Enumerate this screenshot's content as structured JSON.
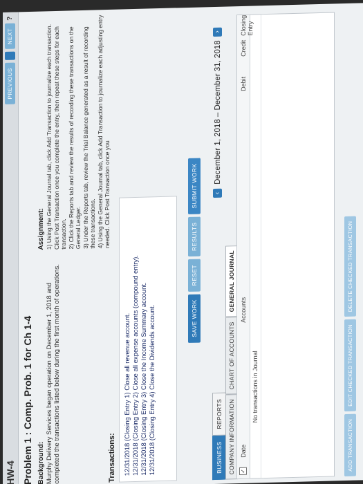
{
  "header": {
    "hw_title": "HW-4",
    "previous": "Previous",
    "next": "Next",
    "help": "?"
  },
  "problem": {
    "title": "Problem 1 : Comp. Prob. 1 for Ch 1-4"
  },
  "background": {
    "heading": "Background:",
    "text": "Murphy Delivery Services began operation on December 1, 2018 and completed the transactions listed below during the first month of operations."
  },
  "assignment": {
    "heading": "Assignment:",
    "items": [
      "1) Using the General Journal tab, click Add Transaction to journalize each transaction. Click Post Transaction once you complete the entry, then repeat these steps for each transaction.",
      "2) Click the Reports tab and review the results of recording these transactions on the General Ledger.",
      "3) Under the Reports tab, review the Trial Balance generated as a result of recording these transactions.",
      "4) Using the General Journal tab, click Add Transaction to journalize each adjusting entry needed. Click Post Transaction once you"
    ]
  },
  "transactions": {
    "heading": "Transactions:",
    "items": [
      "12/31/2018 (Closing Entry 1) Close all revenue account.",
      "12/31/2018 (Closing Entry 2) Close all expense accounts (compound entry).",
      "12/31/2018 (Closing Entry 3) Close the Income Summary account.",
      "12/31/2018 (Closing Entry 4) Close the Dividends account."
    ]
  },
  "actions": {
    "save": "Save Work",
    "reset": "Reset",
    "results": "Results",
    "submit": "Submit Work"
  },
  "tabs_top": [
    "Business",
    "Reports"
  ],
  "date_range": "December 1, 2018 – December 31, 2018",
  "tabs_sub": [
    "Company Information",
    "Chart of Accounts",
    "General Journal"
  ],
  "journal": {
    "columns": {
      "date": "Date",
      "accounts": "Accounts",
      "debit": "Debit",
      "credit": "Credit",
      "closing": "Closing Entry"
    },
    "empty_message": "No transactions in Journal"
  },
  "bottom_actions": [
    "Add Transaction",
    "Edit Checked Transaction",
    "Delete Checked Transaction"
  ]
}
